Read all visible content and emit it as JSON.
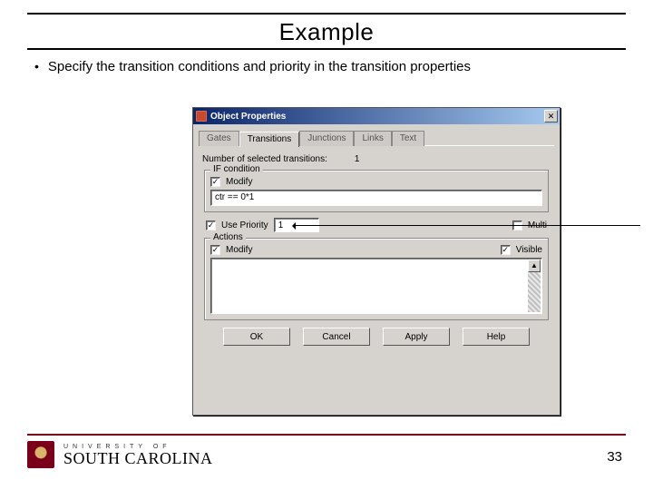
{
  "title": "Example",
  "bullet_text": "Specify the transition conditions and priority in the transition properties",
  "dialog": {
    "title": "Object Properties",
    "tabs": [
      "Gates",
      "Transitions",
      "Junctions",
      "Links",
      "Text"
    ],
    "active_tab": 1,
    "selected_label": "Number of selected transitions:",
    "selected_value": "1",
    "fs_condition_legend": "IF condition",
    "modify1": "Modify",
    "condition_value": "ctr == 0*1",
    "use_priority_label": "Use Priority",
    "priority_value": "1",
    "multi_label": "Multi",
    "fs_actions_legend": "Actions",
    "modify2": "Modify",
    "visible_label": "Visible",
    "buttons": {
      "ok": "OK",
      "cancel": "Cancel",
      "apply": "Apply",
      "help": "Help"
    }
  },
  "footer": {
    "uni_top": "UNIVERSITY OF",
    "uni_main": "SOUTH CAROLINA",
    "page": "33"
  }
}
